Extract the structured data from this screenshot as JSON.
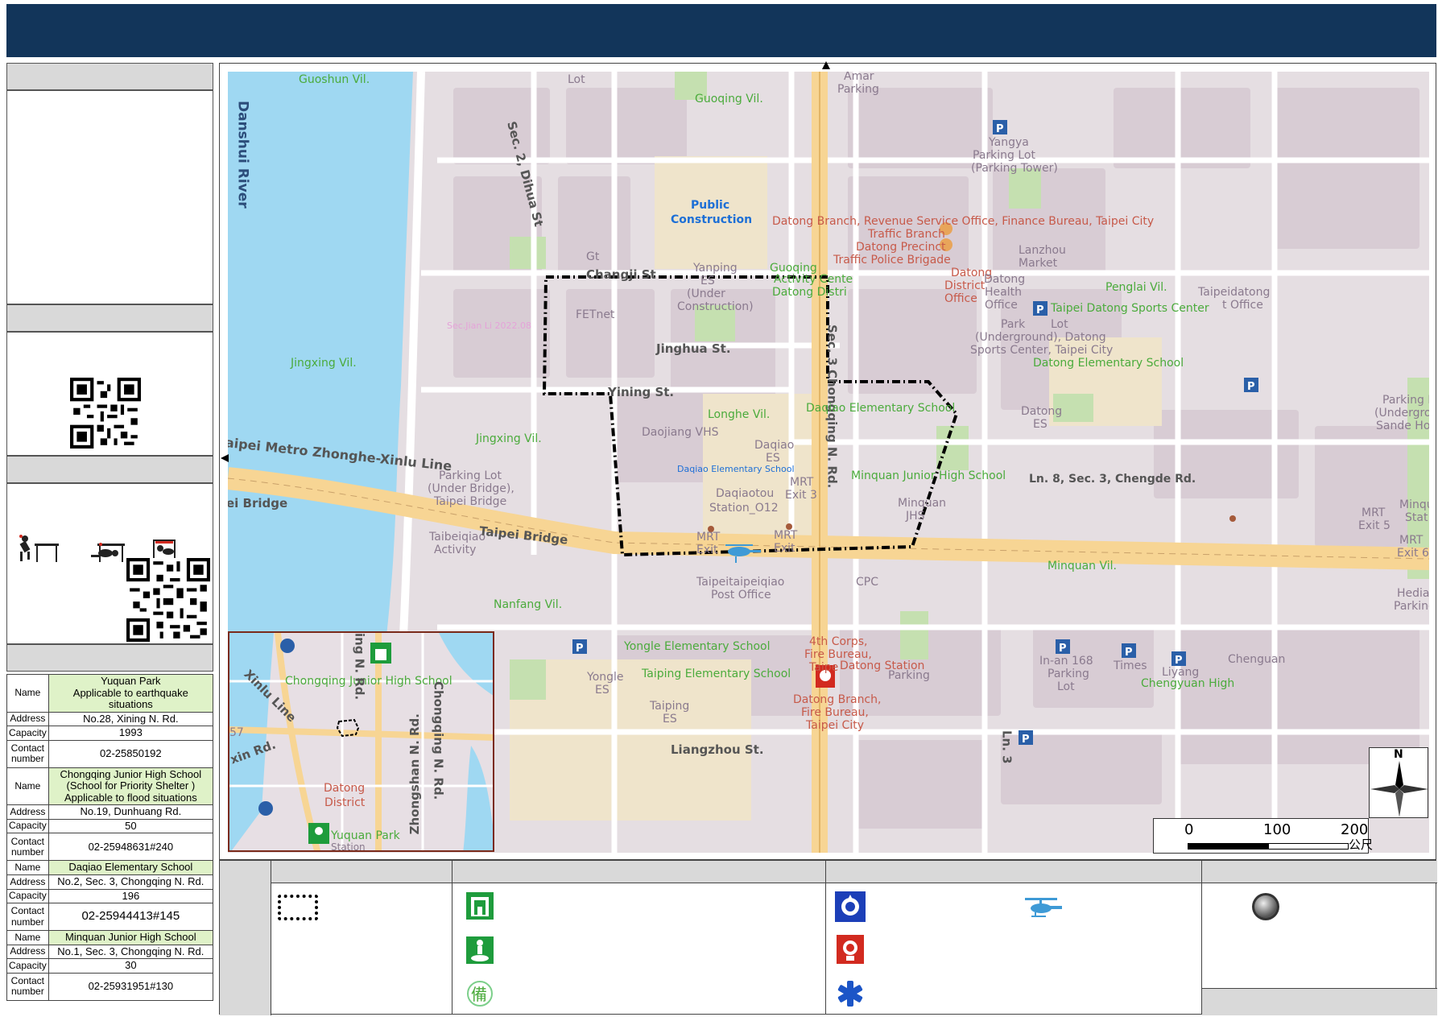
{
  "sidebar": {
    "shelters": [
      {
        "name_key": "Name",
        "name": "Yuquan Park",
        "note": "Applicable to earthquake situations",
        "address_key": "Address",
        "address": "No.28, Xining N. Rd.",
        "capacity_key": "Capacity",
        "capacity": "1993",
        "contact_key": "Contact number",
        "contact": "02-25850192"
      },
      {
        "name_key": "Name",
        "name": "Chongqing Junior High School",
        "name2": "(School for Priority Shelter )",
        "note": "Applicable to flood situations",
        "address_key": "Address",
        "address": "No.19, Dunhuang Rd.",
        "capacity_key": "Capacity",
        "capacity": "50",
        "contact_key": "Contact number",
        "contact": "02-25948631#240"
      },
      {
        "name_key": "Name",
        "name": "Daqiao Elementary School",
        "address_key": "Address",
        "address": "No.2, Sec. 3, Chongqing N. Rd.",
        "capacity_key": "Capacity",
        "capacity": "196",
        "contact_key": "Contact number",
        "contact": "02-25944413#145"
      },
      {
        "name_key": "Name",
        "name": "Minquan Junior High School",
        "address_key": "Address",
        "address": "No.1, Sec. 3, Chongqing N. Rd.",
        "capacity_key": "Capacity",
        "capacity": "30",
        "contact_key": "Contact number",
        "contact": "02-25931951#130"
      }
    ]
  },
  "map": {
    "labels": {
      "guoshun": "Guoshun Vil.",
      "lot": "Lot",
      "amar": "Amar",
      "parking": "Parking",
      "guoqing_vil": "Guoqing Vil.",
      "danshui": "Danshui River",
      "dihua": "Sec. 2, Dihua St",
      "yangya": "Yangya",
      "yangya2": "Parking Lot",
      "yangya3": "(Parking Tower)",
      "public": "Public",
      "construction": "Construction",
      "datong_branch": "Datong Branch, Revenue Service Office, Finance Bureau, Taipei City",
      "traffic_branch": "Traffic Branch",
      "datong_precinct": "Datong Precinct",
      "traffic_police": "Traffic Police Brigade",
      "lanzhou": "Lanzhou",
      "market": "Market",
      "gt": "Gt",
      "yanping": "Yanping",
      "yanping_es": "ES",
      "under_construction": "(Under",
      "under_construction2": "Construction)",
      "guoqing": "Guoqing",
      "activity": "Activity Cente",
      "datong_distri": "Datong Distri",
      "changji": "Changji St",
      "datong_district": "Datong",
      "datong_district2": "District",
      "datong_district3": "Office",
      "datong_health": "Datong",
      "health2": "Health",
      "health3": "Office",
      "penglai": "Penglai Vil.",
      "sports_center": "Taipei Datong Sports Center",
      "taipeidatong": "Taipeidatong",
      "t_office": "t Office",
      "park_lot": "Park",
      "lot2": "Lot",
      "underground": "(Underground), Datong",
      "sports_center2": "Sports Center, Taipei City",
      "datong_es_school": "Datong Elementary School",
      "fetnet": "FETnet",
      "jingxing_vil_left": "Jingxing Vil.",
      "jinghua": "Jinghua St.",
      "sec3": "Sec. 3",
      "chongqing_rd": "Chongqing N. Rd.",
      "yining": "Yining St.",
      "longhe": "Longhe Vil.",
      "daqiao_es_school": "Daqiao Elementary School",
      "daojiang": "Daojiang VHS",
      "daqiao": "Daqiao",
      "daqiao_es": "ES",
      "datong_es": "Datong",
      "datong_es2": "ES",
      "parking_lo": "Parking Lo",
      "underground2": "(Undergroun",
      "sande": "Sande Hote",
      "metro": "aipei Metro Zhonghe-Xinlu Line",
      "jingxing_vil": "Jingxing Vil.",
      "daqiao_es_small": "Daqiao Elementary School",
      "mrt": "MRT",
      "exit3": "Exit 3",
      "minquan_jhs_school": "Minquan Junior High School",
      "ln8": "Ln. 8, Sec. 3, Chengde Rd.",
      "parking_lot_bridge": "Parking Lot",
      "under_bridge": "(Under Bridge),",
      "taipei_bridge_lot": "Taipei Bridge",
      "ei_bridge": "ei Bridge",
      "daqiaotou": "Daqiaotou",
      "station_o12": "Station_O12",
      "minquan": "Minquan",
      "jhs": "JHS",
      "minq": "Minqu",
      "stat": "Stat",
      "mrt_exit5": "MRT",
      "exit5": "Exit 5",
      "mrt_exit6": "MRT",
      "exit6": "Exit 6",
      "taibeiqiao": "Taibeiqiao",
      "activity2": "Activity",
      "taipei_bridge": "Taipei Bridge",
      "mrt_exit": "MRT",
      "exit_label": "Exit",
      "mrt_exit_b": "MRT",
      "exit_b": "Exit",
      "minquan_vil": "Minquan Vil.",
      "cpc": "CPC",
      "taipeitaipeiqiao": "Taipeitaipeiqiao",
      "post_office": "Post Office",
      "hedian": "Hedian",
      "parking2": "Parking",
      "nanfang": "Nanfang Vil.",
      "yongle_school": "Yongle Elementary School",
      "fourth_corps": "4th Corps,",
      "fire_bureau": "Fire Bureau,",
      "taipe": "Taipe",
      "datong_station": "Datong Station",
      "parking3": "Parking",
      "in_an": "In-an 168",
      "in_an2": "Parking",
      "in_an3": "Lot",
      "times": "Times",
      "liyang": "Liyang",
      "chenguan": "Chenguan",
      "chengyuan": "Chengyuan High",
      "yongle": "Yongle",
      "yongle_es": "ES",
      "taiping_school": "Taiping Elementary School",
      "taiping": "Taiping",
      "taiping_es": "ES",
      "datong_branch_fire": "Datong Branch,",
      "fire_bureau2": "Fire Bureau,",
      "taipei_city": "Taipei City",
      "liangzhou": "Liangzhou St.",
      "ln": "Ln. 3",
      "watermark": "Sec.Jian Li 2022.08"
    },
    "inset": {
      "chongqing": "Chongqing Junior High School",
      "datong": "Datong",
      "datong2": "District",
      "yuquan": "Yuquan Park",
      "zhongshan": "Zhongshan N. Rd.",
      "xinlu": "Xinlu Line",
      "xin_rd": "xin Rd.",
      "ming": "ing N. Rd.",
      "chongqing_n": "Chongqing N. Rd.",
      "n57": "57",
      "station": "Station"
    },
    "scale": {
      "s0": "0",
      "s100": "100",
      "s200": "200",
      "unit": "公尺"
    },
    "compass_n": "N"
  },
  "colors": {
    "header": "#12355a",
    "river": "#9fd8f2",
    "major_road": "#f9d898",
    "green_area": "#c7e2b3",
    "school_area": "#f0e5cc",
    "shelter_green": "#1e9c3c",
    "police_blue": "#1c3fb8",
    "fire_red": "#d22a1f"
  },
  "icons": [
    "shelter-building-icon",
    "shelter-park-icon",
    "standby-shelter-icon",
    "police-icon",
    "fire-icon",
    "ambulance-icon",
    "helicopter-icon",
    "assembly-point-icon",
    "qr-code-icon",
    "drop-cover-hold-icon"
  ]
}
